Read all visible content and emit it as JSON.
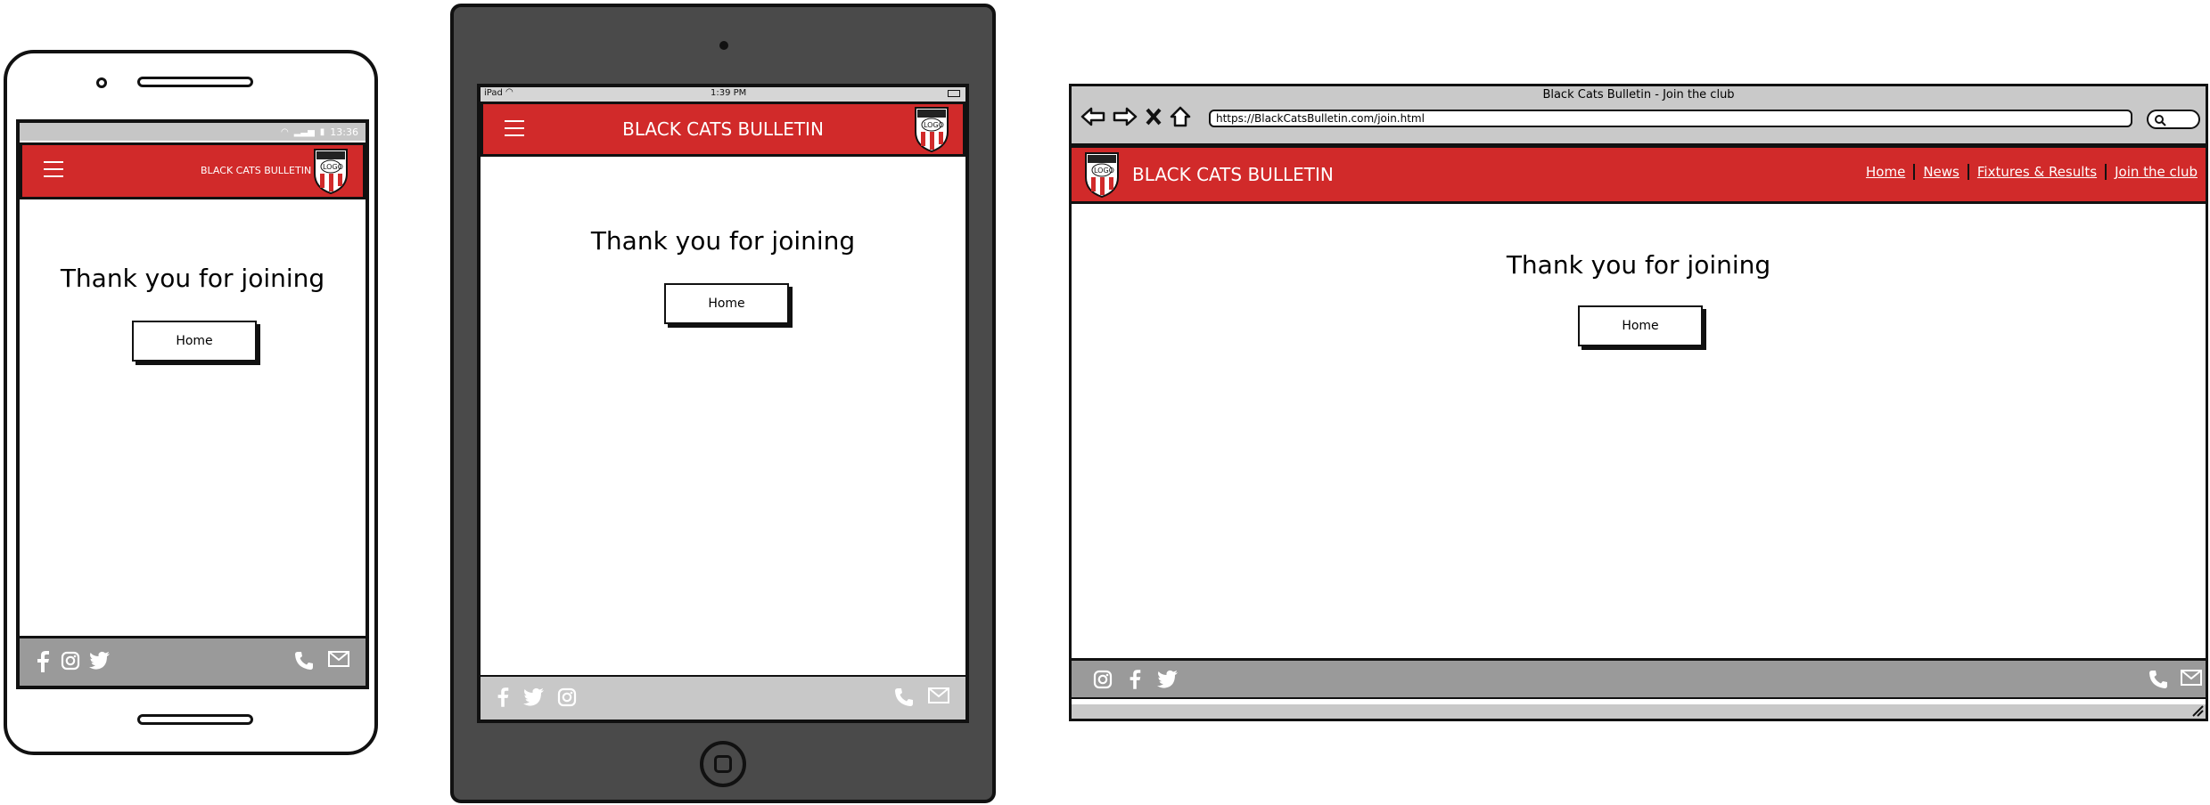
{
  "brand": {
    "name": "BLACK CATS BULLETIN",
    "logo_label": "LOGO",
    "accent": "#d12a2a"
  },
  "content": {
    "heading": "Thank you for joining",
    "home_button": "Home"
  },
  "mobile": {
    "status_time": "13:36"
  },
  "tablet": {
    "status_device": "iPad",
    "status_time": "1:39 PM"
  },
  "desktop": {
    "window_title": "Black Cats Bulletin - Join the club",
    "url": "https://BlackCatsBulletin.com/join.html",
    "nav": [
      {
        "label": "Home"
      },
      {
        "label": "News"
      },
      {
        "label": "Fixtures & Results"
      },
      {
        "label": "Join the club"
      }
    ]
  },
  "icons": {
    "mobile_footer_left": [
      "facebook-icon",
      "instagram-icon",
      "twitter-icon"
    ],
    "tablet_footer_left": [
      "facebook-icon",
      "twitter-icon",
      "instagram-icon"
    ],
    "desktop_footer_left": [
      "instagram-icon",
      "facebook-icon",
      "twitter-icon"
    ],
    "footer_right": [
      "phone-icon",
      "mail-icon"
    ]
  }
}
